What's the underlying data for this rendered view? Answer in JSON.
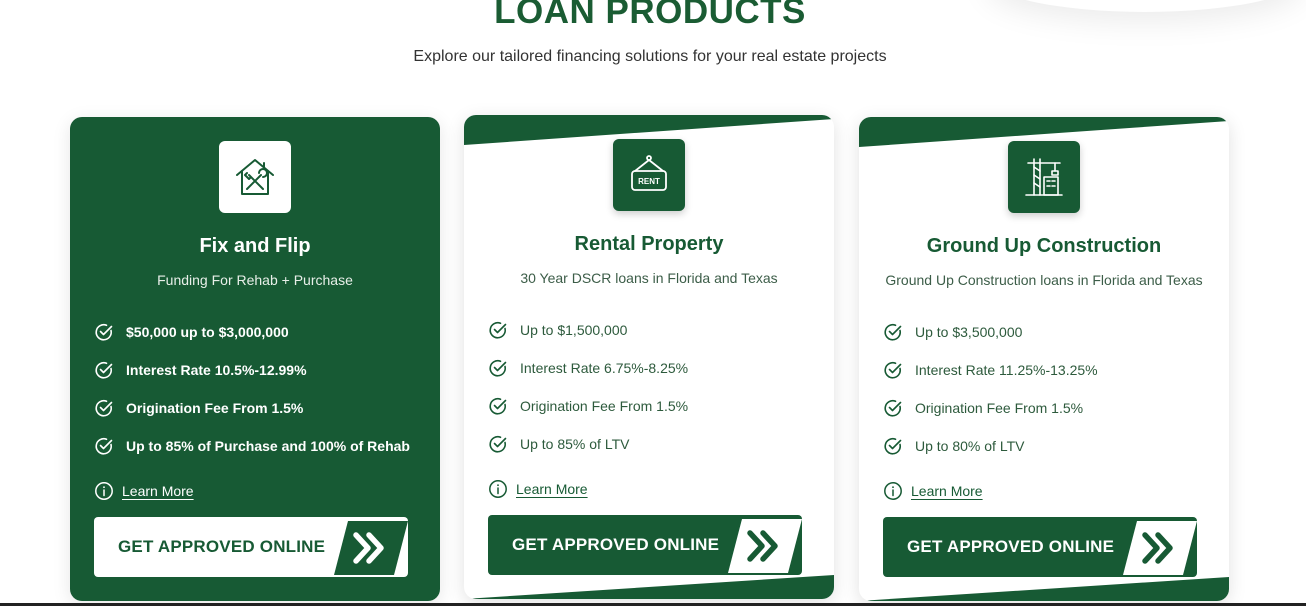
{
  "section": {
    "title": "LOAN PRODUCTS",
    "subtitle": "Explore our tailored financing solutions for your real estate projects"
  },
  "colors": {
    "brand_green": "#175a34",
    "white": "#ffffff"
  },
  "cards": [
    {
      "icon": "house-tools-icon",
      "title": "Fix and Flip",
      "subtitle": "Funding For Rehab + Purchase",
      "features": [
        "$50,000 up to $3,000,000",
        "Interest Rate 10.5%-12.99%",
        "Origination Fee From 1.5%",
        "Up to 85% of Purchase and 100% of Rehab"
      ],
      "learn_more": "Learn More",
      "cta": "GET APPROVED ONLINE"
    },
    {
      "icon": "rent-sign-icon",
      "title": "Rental Property",
      "subtitle": "30 Year DSCR loans in Florida and Texas",
      "features": [
        "Up to $1,500,000",
        "Interest Rate 6.75%-8.25%",
        "Origination Fee From 1.5%",
        "Up to 85% of LTV"
      ],
      "learn_more": "Learn More",
      "cta": "GET APPROVED ONLINE"
    },
    {
      "icon": "construction-crane-icon",
      "title": "Ground Up Construction",
      "subtitle": "Ground Up Construction loans in Florida and Texas",
      "features": [
        "Up to $3,500,000",
        "Interest Rate 11.25%-13.25%",
        "Origination Fee From 1.5%",
        "Up to 80% of LTV"
      ],
      "learn_more": "Learn More",
      "cta": "GET APPROVED ONLINE"
    }
  ]
}
